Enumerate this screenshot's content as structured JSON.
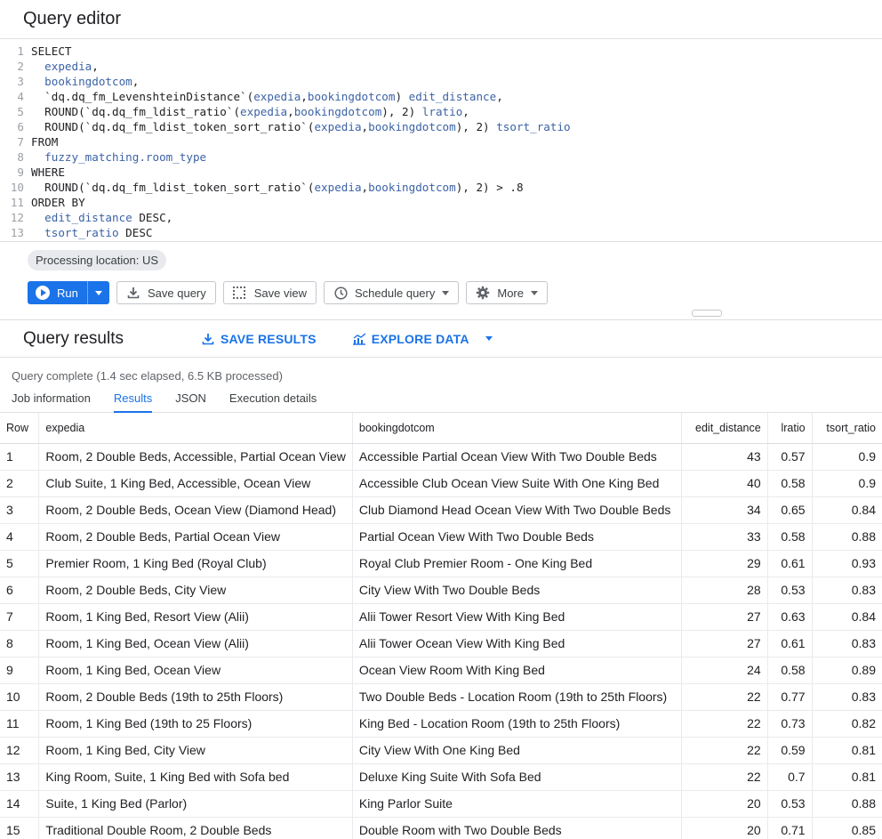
{
  "editor": {
    "title": "Query editor",
    "code_lines": [
      {
        "n": "1",
        "segs": [
          {
            "t": "SELECT",
            "c": "kw"
          }
        ]
      },
      {
        "n": "2",
        "segs": [
          {
            "t": "  ",
            "c": "txt"
          },
          {
            "t": "expedia",
            "c": "id"
          },
          {
            "t": ",",
            "c": "txt"
          }
        ]
      },
      {
        "n": "3",
        "segs": [
          {
            "t": "  ",
            "c": "txt"
          },
          {
            "t": "bookingdotcom",
            "c": "id"
          },
          {
            "t": ",",
            "c": "txt"
          }
        ]
      },
      {
        "n": "4",
        "segs": [
          {
            "t": "  `dq.dq_fm_LevenshteinDistance`(",
            "c": "txt"
          },
          {
            "t": "expedia",
            "c": "id"
          },
          {
            "t": ",",
            "c": "txt"
          },
          {
            "t": "bookingdotcom",
            "c": "id"
          },
          {
            "t": ") ",
            "c": "txt"
          },
          {
            "t": "edit_distance",
            "c": "id"
          },
          {
            "t": ",",
            "c": "txt"
          }
        ]
      },
      {
        "n": "5",
        "segs": [
          {
            "t": "  ROUND(`dq.dq_fm_ldist_ratio`(",
            "c": "txt"
          },
          {
            "t": "expedia",
            "c": "id"
          },
          {
            "t": ",",
            "c": "txt"
          },
          {
            "t": "bookingdotcom",
            "c": "id"
          },
          {
            "t": "), 2) ",
            "c": "txt"
          },
          {
            "t": "lratio",
            "c": "id"
          },
          {
            "t": ",",
            "c": "txt"
          }
        ]
      },
      {
        "n": "6",
        "segs": [
          {
            "t": "  ROUND(`dq.dq_fm_ldist_token_sort_ratio`(",
            "c": "txt"
          },
          {
            "t": "expedia",
            "c": "id"
          },
          {
            "t": ",",
            "c": "txt"
          },
          {
            "t": "bookingdotcom",
            "c": "id"
          },
          {
            "t": "), 2) ",
            "c": "txt"
          },
          {
            "t": "tsort_ratio",
            "c": "id"
          }
        ]
      },
      {
        "n": "7",
        "segs": [
          {
            "t": "FROM",
            "c": "kw"
          }
        ]
      },
      {
        "n": "8",
        "segs": [
          {
            "t": "  ",
            "c": "txt"
          },
          {
            "t": "fuzzy_matching.room_type",
            "c": "id"
          }
        ]
      },
      {
        "n": "9",
        "segs": [
          {
            "t": "WHERE",
            "c": "kw"
          }
        ]
      },
      {
        "n": "10",
        "segs": [
          {
            "t": "  ROUND(`dq.dq_fm_ldist_token_sort_ratio`(",
            "c": "txt"
          },
          {
            "t": "expedia",
            "c": "id"
          },
          {
            "t": ",",
            "c": "txt"
          },
          {
            "t": "bookingdotcom",
            "c": "id"
          },
          {
            "t": "), 2) > .8",
            "c": "txt"
          }
        ]
      },
      {
        "n": "11",
        "segs": [
          {
            "t": "ORDER BY",
            "c": "kw"
          }
        ]
      },
      {
        "n": "12",
        "segs": [
          {
            "t": "  ",
            "c": "txt"
          },
          {
            "t": "edit_distance",
            "c": "id"
          },
          {
            "t": " DESC,",
            "c": "txt"
          }
        ]
      },
      {
        "n": "13",
        "segs": [
          {
            "t": "  ",
            "c": "txt"
          },
          {
            "t": "tsort_ratio",
            "c": "id"
          },
          {
            "t": " DESC",
            "c": "txt"
          }
        ]
      }
    ],
    "processing_location": "Processing location: US"
  },
  "toolbar": {
    "run_label": "Run",
    "save_query_label": "Save query",
    "save_view_label": "Save view",
    "schedule_label": "Schedule query",
    "more_label": "More"
  },
  "results": {
    "title": "Query results",
    "save_results_label": "SAVE RESULTS",
    "explore_label": "EXPLORE DATA",
    "status": "Query complete (1.4 sec elapsed, 6.5 KB processed)",
    "tabs": [
      "Job information",
      "Results",
      "JSON",
      "Execution details"
    ],
    "active_tab": "Results",
    "columns": [
      "Row",
      "expedia",
      "bookingdotcom",
      "edit_distance",
      "lratio",
      "tsort_ratio"
    ],
    "rows": [
      [
        "1",
        "Room, 2 Double Beds, Accessible, Partial Ocean View",
        "Accessible Partial Ocean View With Two Double Beds",
        "43",
        "0.57",
        "0.9"
      ],
      [
        "2",
        "Club Suite, 1 King Bed, Accessible, Ocean View",
        "Accessible Club Ocean View Suite With One King Bed",
        "40",
        "0.58",
        "0.9"
      ],
      [
        "3",
        "Room, 2 Double Beds, Ocean View (Diamond Head)",
        "Club Diamond Head Ocean View With Two Double Beds",
        "34",
        "0.65",
        "0.84"
      ],
      [
        "4",
        "Room, 2 Double Beds, Partial Ocean View",
        "Partial Ocean View With Two Double Beds",
        "33",
        "0.58",
        "0.88"
      ],
      [
        "5",
        "Premier Room, 1 King Bed (Royal Club)",
        "Royal Club Premier Room - One King Bed",
        "29",
        "0.61",
        "0.93"
      ],
      [
        "6",
        "Room, 2 Double Beds, City View",
        "City View With Two Double Beds",
        "28",
        "0.53",
        "0.83"
      ],
      [
        "7",
        "Room, 1 King Bed, Resort View (Alii)",
        "Alii Tower Resort View With King Bed",
        "27",
        "0.63",
        "0.84"
      ],
      [
        "8",
        "Room, 1 King Bed, Ocean View (Alii)",
        "Alii Tower Ocean View With King Bed",
        "27",
        "0.61",
        "0.83"
      ],
      [
        "9",
        "Room, 1 King Bed, Ocean View",
        "Ocean View Room With King Bed",
        "24",
        "0.58",
        "0.89"
      ],
      [
        "10",
        "Room, 2 Double Beds (19th to 25th Floors)",
        "Two Double Beds - Location Room (19th to 25th Floors)",
        "22",
        "0.77",
        "0.83"
      ],
      [
        "11",
        "Room, 1 King Bed (19th to 25 Floors)",
        "King Bed - Location Room (19th to 25th Floors)",
        "22",
        "0.73",
        "0.82"
      ],
      [
        "12",
        "Room, 1 King Bed, City View",
        "City View With One King Bed",
        "22",
        "0.59",
        "0.81"
      ],
      [
        "13",
        "King Room, Suite, 1 King Bed with Sofa bed",
        "Deluxe King Suite With Sofa Bed",
        "22",
        "0.7",
        "0.81"
      ],
      [
        "14",
        "Suite, 1 King Bed (Parlor)",
        "King Parlor Suite",
        "20",
        "0.53",
        "0.88"
      ],
      [
        "15",
        "Traditional Double Room, 2 Double Beds",
        "Double Room with Two Double Beds",
        "20",
        "0.71",
        "0.85"
      ]
    ]
  },
  "colors": {
    "accent": "#1a73e8",
    "identifier": "#3c63a6"
  }
}
